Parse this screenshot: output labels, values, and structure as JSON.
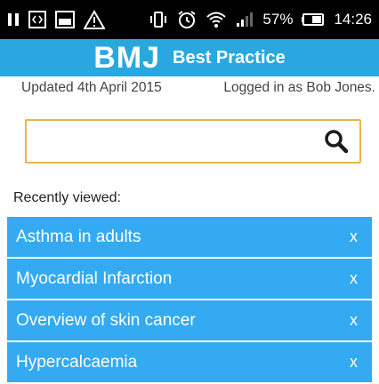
{
  "status_bar": {
    "icons_left": [
      "pause-icon",
      "code-icon",
      "image-icon",
      "warning-icon"
    ],
    "icons_right": [
      "vibrate-icon",
      "alarm-icon",
      "wifi-icon",
      "signal-icon"
    ],
    "battery": "57%",
    "time": "14:26"
  },
  "header": {
    "brand": "BMJ",
    "product": "Best Practice",
    "color": "#29a8e0"
  },
  "meta": {
    "updated": "Updated 4th April 2015",
    "logged_in": "Logged in as Bob Jones."
  },
  "search": {
    "value": "",
    "placeholder": "",
    "border_color": "#e8b64a"
  },
  "recent": {
    "label": "Recently viewed:",
    "remove_label": "x",
    "item_color": "#33aaf2",
    "items": [
      {
        "title": "Asthma in adults"
      },
      {
        "title": "Myocardial Infarction"
      },
      {
        "title": "Overview of skin cancer"
      },
      {
        "title": "Hypercalcaemia"
      }
    ]
  }
}
